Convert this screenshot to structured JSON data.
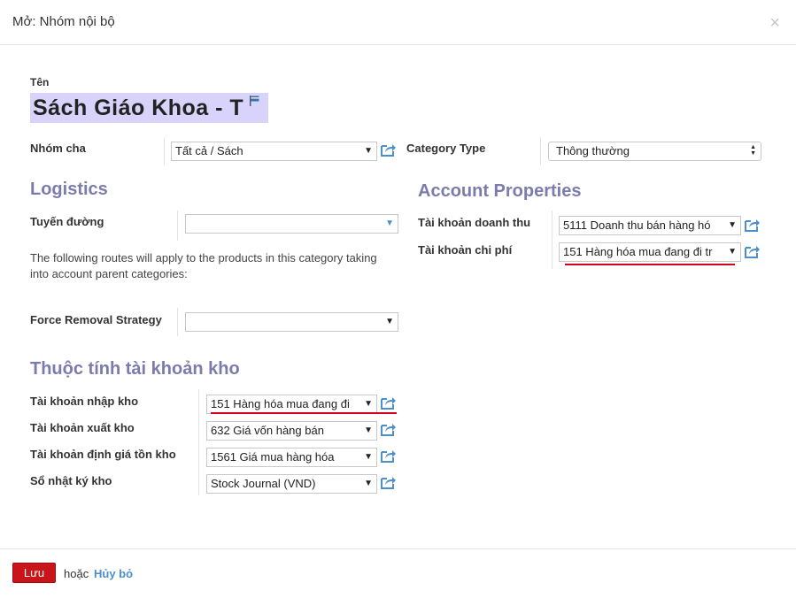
{
  "dialog": {
    "title": "Mở: Nhóm nội bộ",
    "close_glyph": "×"
  },
  "name": {
    "label": "Tên",
    "value": "Sách Giáo Khoa - T"
  },
  "parent": {
    "label": "Nhóm cha",
    "value": "Tất cả / Sách"
  },
  "category_type": {
    "label": "Category Type",
    "value": "Thông thường"
  },
  "logistics": {
    "title": "Logistics",
    "routes_label": "Tuyến đường",
    "routes_value": "",
    "routes_help": "The following routes will apply to the products in this category taking into account parent categories:",
    "removal_label": "Force Removal Strategy",
    "removal_value": ""
  },
  "account_properties": {
    "title": "Account Properties",
    "income_label": "Tài khoản doanh thu",
    "income_value": "5111 Doanh thu bán hàng hó",
    "expense_label": "Tài khoản chi phí",
    "expense_value": "151 Hàng hóa mua đang đi tr"
  },
  "stock_accounts": {
    "title": "Thuộc tính tài khoản kho",
    "input_label": "Tài khoản nhập kho",
    "input_value": "151 Hàng hóa mua đang đi",
    "output_label": "Tài khoản xuất kho",
    "output_value": "632 Giá vốn hàng bán",
    "valuation_label": "Tài khoản định giá tồn kho",
    "valuation_value": "1561 Giá mua hàng hóa",
    "journal_label": "Sổ nhật ký kho",
    "journal_value": "Stock Journal (VND)"
  },
  "footer": {
    "save_label": "Lưu",
    "or_text": "hoặc",
    "cancel_label": "Hủy bỏ"
  },
  "colors": {
    "accent": "#7c7bad",
    "link": "#4b8fcb",
    "save": "#c9141a",
    "highlight": "#d7d3fa",
    "underline": "#d0021b"
  },
  "icons": {
    "external_link": "external-link-icon",
    "close": "close-icon",
    "dropdown": "chevron-down-icon",
    "translate_flag": "flag-icon"
  }
}
